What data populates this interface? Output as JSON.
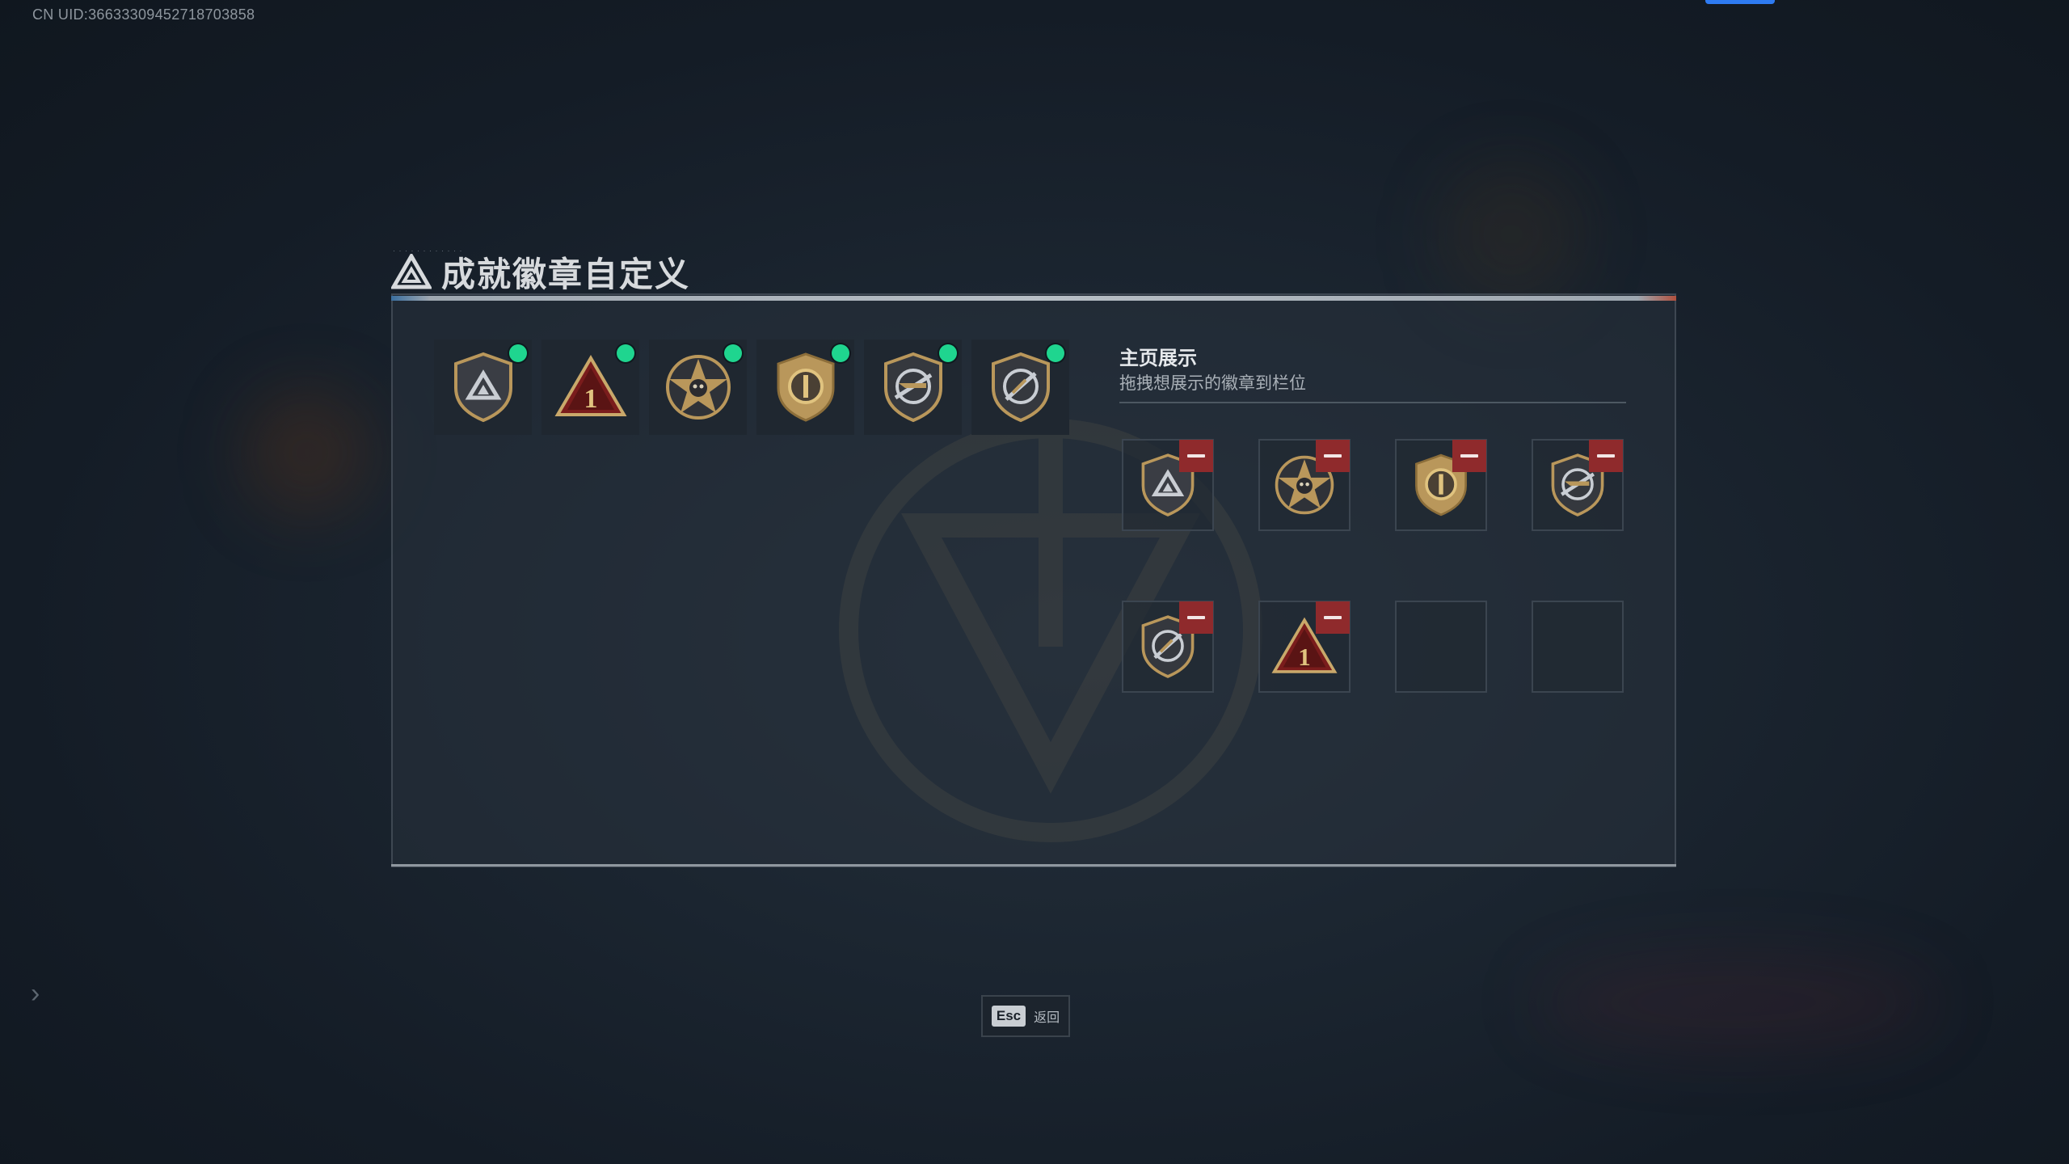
{
  "uid_text": "CN UID:36633309452718703858",
  "title": "成就徽章自定义",
  "owned_badges": [
    {
      "icon": "shield-triangle-badge",
      "new": true
    },
    {
      "icon": "rank-one-triangle-badge",
      "new": true
    },
    {
      "icon": "star-skull-badge",
      "new": true
    },
    {
      "icon": "shield-circle-badge",
      "new": true
    },
    {
      "icon": "shield-rifle-badge",
      "new": true
    },
    {
      "icon": "shield-crossed-circle-badge",
      "new": true
    }
  ],
  "showcase": {
    "title": "主页展示",
    "subtitle": "拖拽想展示的徽章到栏位",
    "slots": [
      {
        "icon": "shield-triangle-badge",
        "filled": true
      },
      {
        "icon": "star-skull-badge",
        "filled": true
      },
      {
        "icon": "shield-circle-badge",
        "filled": true
      },
      {
        "icon": "shield-rifle-badge",
        "filled": true
      },
      {
        "icon": "shield-crossed-circle-badge",
        "filled": true
      },
      {
        "icon": "rank-one-triangle-badge",
        "filled": true
      },
      {
        "icon": "",
        "filled": false
      },
      {
        "icon": "",
        "filled": false
      }
    ]
  },
  "footer": {
    "esc_key": "Esc",
    "esc_label": "返回"
  },
  "colors": {
    "new_dot": "#1fd58f",
    "remove_button": "#8f2a2c",
    "accent_blue": "#2e7bf2",
    "badge_gold": "#b9975b"
  }
}
